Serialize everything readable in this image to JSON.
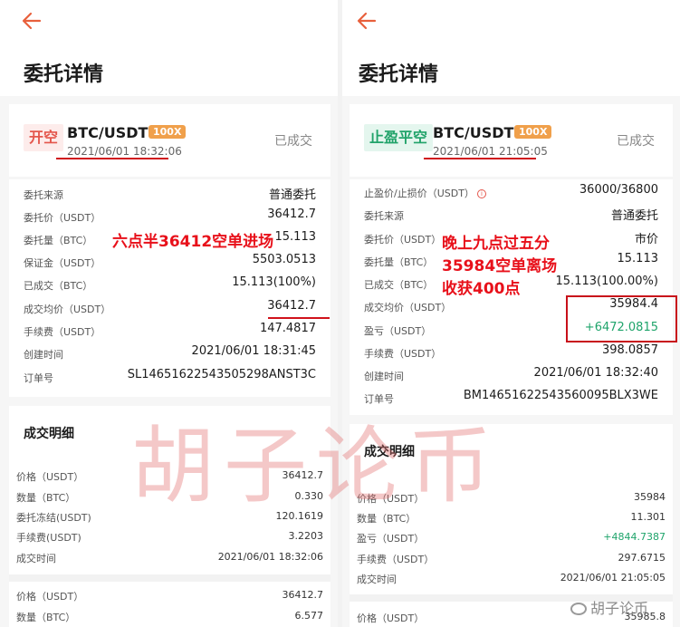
{
  "left": {
    "page_title": "委托详情",
    "side_badge": "开空",
    "pair": "BTC/USDT",
    "leverage": "100X",
    "time": "2021/06/01 18:32:06",
    "status": "已成交",
    "rows": [
      {
        "label": "委托来源",
        "value": "普通委托"
      },
      {
        "label": "委托价（USDT）",
        "value": "36412.7"
      },
      {
        "label": "委托量（BTC）",
        "value": "15.113"
      },
      {
        "label": "保证金（USDT）",
        "value": "5503.0513"
      },
      {
        "label": "已成交（BTC）",
        "value": "15.113(100%)"
      },
      {
        "label": "成交均价（USDT）",
        "value": "36412.7"
      },
      {
        "label": "手续费（USDT）",
        "value": "147.4817"
      },
      {
        "label": "创建时间",
        "value": "2021/06/01 18:31:45"
      },
      {
        "label": "订单号",
        "value": "SL14651622543505298ANST3C"
      }
    ],
    "fills_title": "成交明细",
    "fills": [
      [
        {
          "label": "价格（USDT）",
          "value": "36412.7"
        },
        {
          "label": "数量（BTC）",
          "value": "0.330"
        },
        {
          "label": "委托冻结(USDT)",
          "value": "120.1619"
        },
        {
          "label": "手续费(USDT)",
          "value": "3.2203"
        },
        {
          "label": "成交时间",
          "value": "2021/06/01 18:32:06"
        }
      ],
      [
        {
          "label": "价格（USDT）",
          "value": "36412.7"
        },
        {
          "label": "数量（BTC）",
          "value": "6.577"
        }
      ]
    ],
    "annotation": "六点半36412空单进场"
  },
  "right": {
    "page_title": "委托详情",
    "side_badge": "止盈平空",
    "pair": "BTC/USDT",
    "leverage": "100X",
    "time": "2021/06/01 21:05:05",
    "status": "已成交",
    "rows": [
      {
        "label": "止盈价/止损价（USDT）",
        "value": "36000/36800"
      },
      {
        "label": "委托来源",
        "value": "普通委托"
      },
      {
        "label": "委托价（USDT）",
        "value": "市价"
      },
      {
        "label": "委托量（BTC）",
        "value": "15.113"
      },
      {
        "label": "已成交（BTC）",
        "value": "15.113(100.00%)"
      },
      {
        "label": "成交均价（USDT）",
        "value": "35984.4"
      },
      {
        "label": "盈亏（USDT）",
        "value": "+6472.0815"
      },
      {
        "label": "手续费（USDT）",
        "value": "398.0857"
      },
      {
        "label": "创建时间",
        "value": "2021/06/01 18:32:40"
      },
      {
        "label": "订单号",
        "value": "BM14651622543560095BLX3WE"
      }
    ],
    "fills_title": "成交明细",
    "fills": [
      [
        {
          "label": "价格（USDT）",
          "value": "35984"
        },
        {
          "label": "数量（BTC）",
          "value": "11.301"
        },
        {
          "label": "盈亏（USDT）",
          "value": "+4844.7387"
        },
        {
          "label": "手续费（USDT）",
          "value": "297.6715"
        },
        {
          "label": "成交时间",
          "value": "2021/06/01 21:05:05"
        }
      ],
      [
        {
          "label": "价格（USDT）",
          "value": "35985.8"
        }
      ]
    ],
    "annotation_lines": [
      "晚上九点过五分",
      "35984空单离场",
      "收获400点"
    ]
  },
  "watermark": "胡子论币",
  "weibo_handle": "胡子论币",
  "colors": {
    "accent": "#e8603c",
    "red_mark": "#d0121b",
    "green": "#1fa46b",
    "leverage_badge": "#f0a04b"
  },
  "icons": {
    "back": "arrow-left-icon",
    "info": "info-circle-icon",
    "weibo": "weibo-logo-icon"
  }
}
